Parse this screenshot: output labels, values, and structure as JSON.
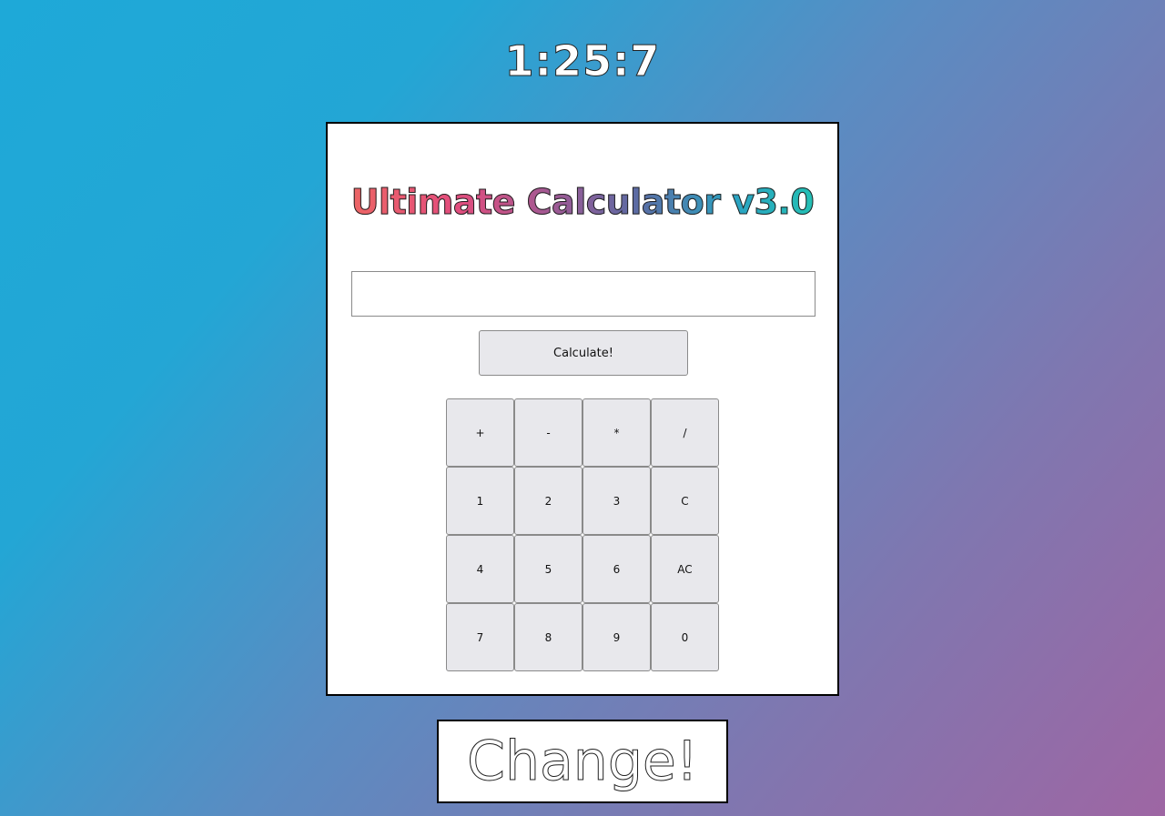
{
  "clock": {
    "time": "1:25:7"
  },
  "calculator": {
    "title": "Ultimate Calculator v3.0",
    "display": {
      "value": "",
      "placeholder": ""
    },
    "calculate_label": "Calculate!",
    "keys": [
      "+",
      "-",
      "*",
      "/",
      "1",
      "2",
      "3",
      "C",
      "4",
      "5",
      "6",
      "AC",
      "7",
      "8",
      "9",
      "0"
    ]
  },
  "change_button": {
    "label": "Change!"
  }
}
